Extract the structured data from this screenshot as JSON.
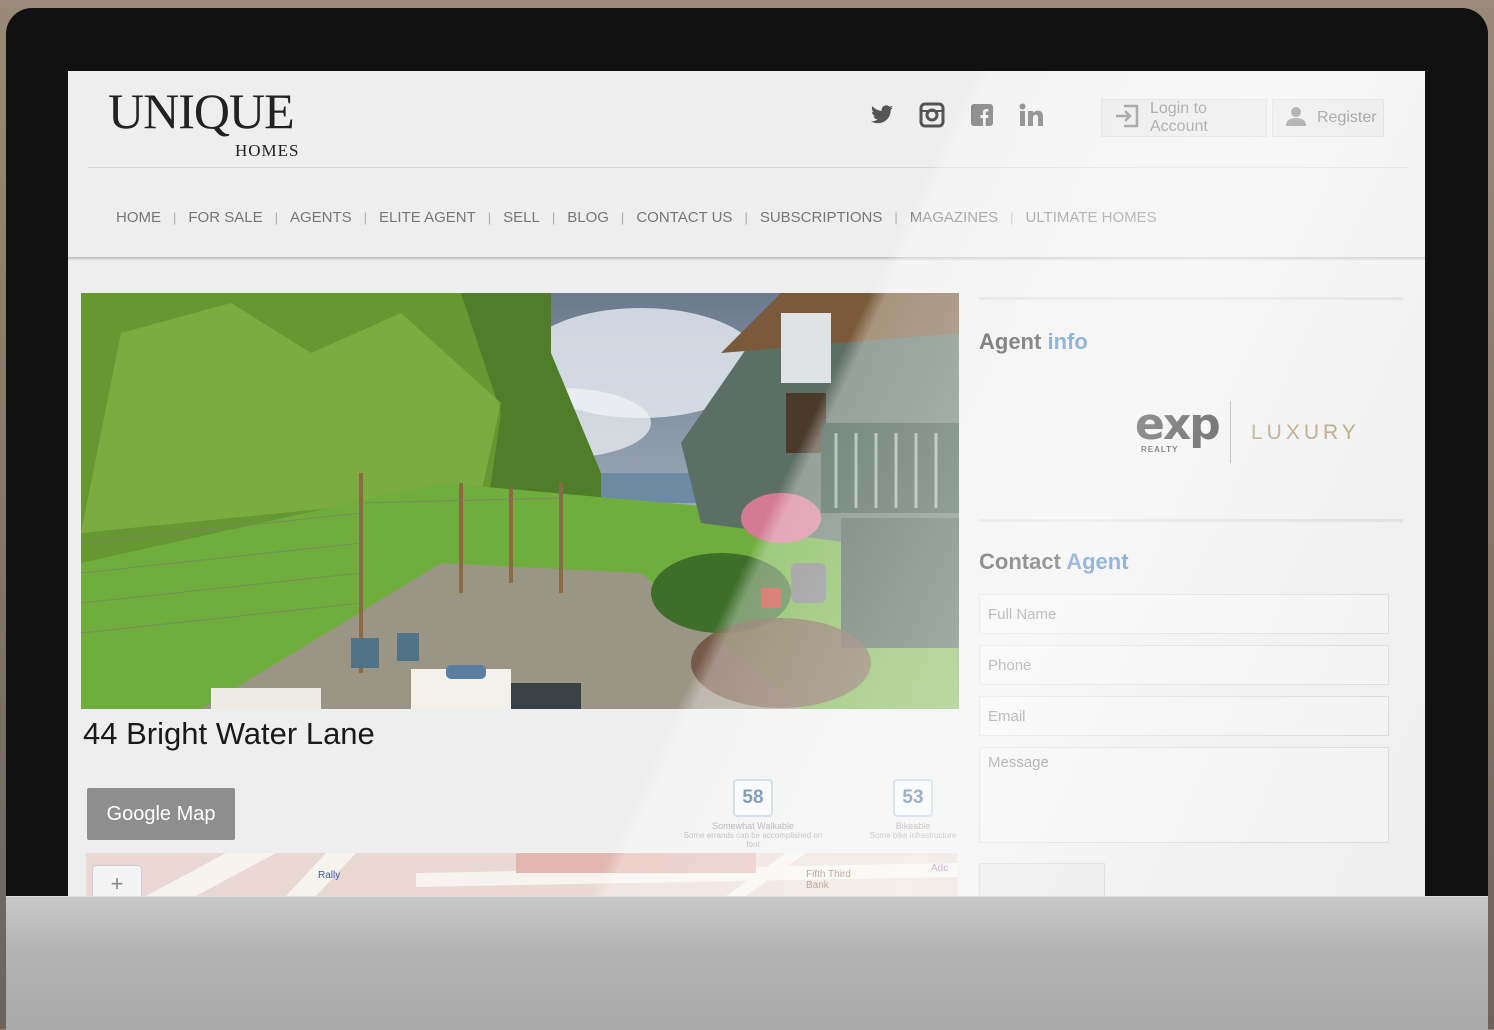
{
  "header": {
    "logo_main": "UNIQUE",
    "logo_sub": "HOMES",
    "social_icons": [
      "twitter-icon",
      "instagram-icon",
      "facebook-icon",
      "linkedin-icon"
    ],
    "login_label": "Login to Account",
    "register_label": "Register"
  },
  "nav": {
    "items": [
      "HOME",
      "FOR SALE",
      "AGENTS",
      "ELITE AGENT",
      "SELL",
      "BLOG",
      "CONTACT US",
      "SUBSCRIPTIONS",
      "MAGAZINES",
      "ULTIMATE HOMES"
    ]
  },
  "listing": {
    "address": "44 Bright Water Lane",
    "google_map_label": "Google Map",
    "walk_score": {
      "value": "58",
      "desc": "Somewhat Walkable",
      "note": "Some errands can be accomplished on foot"
    },
    "bike_score": {
      "value": "53",
      "desc": "Bikeable",
      "note": "Some bike infrastructure"
    },
    "map_labels": [
      "Rally",
      "Fifth Third Bank",
      "Adc"
    ]
  },
  "sidebar": {
    "agent_info_heading": "Agent",
    "agent_info_accent": "info",
    "brand_exp": "exp",
    "brand_realty": "REALTY",
    "brand_luxury": "LUXURY",
    "contact_heading": "Contact",
    "contact_accent": "Agent",
    "full_name_placeholder": "Full Name",
    "phone_placeholder": "Phone",
    "email_placeholder": "Email",
    "message_placeholder": "Message"
  },
  "colors": {
    "accent_blue": "#2d6fb7",
    "button_gray": "#8e8e8e",
    "score_blue": "#2a5a8a"
  }
}
